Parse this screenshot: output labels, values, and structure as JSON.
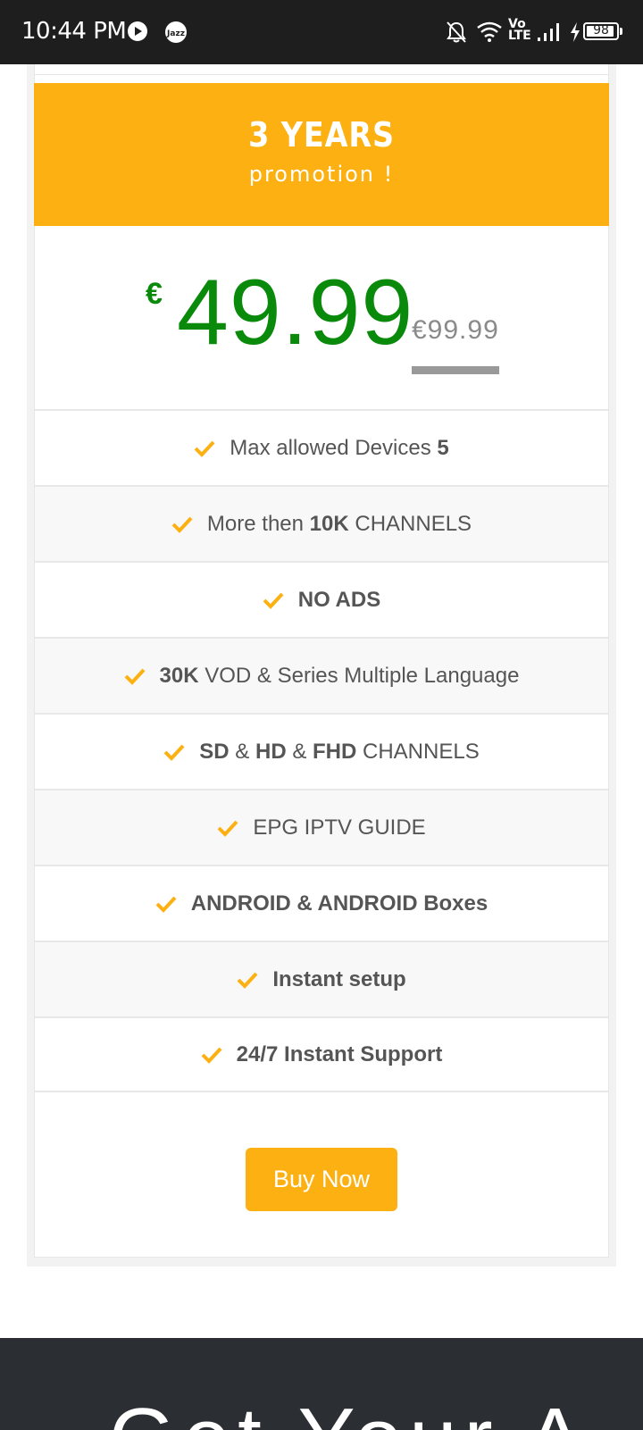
{
  "status_bar": {
    "time": "10:44 PM",
    "battery": "98",
    "network": "Vo LTE"
  },
  "plan": {
    "title": "3 YEARS",
    "subtitle": "promotion !",
    "currency": "€",
    "price": "49.99",
    "old_price": "€99.99",
    "accent_color": "#fdb011",
    "price_color": "#0a8a0a"
  },
  "features": [
    {
      "parts": [
        {
          "t": "Max allowed Devices ",
          "b": false
        },
        {
          "t": "5",
          "b": true
        }
      ]
    },
    {
      "parts": [
        {
          "t": "More then ",
          "b": false
        },
        {
          "t": "10K",
          "b": true
        },
        {
          "t": " CHANNELS",
          "b": false
        }
      ]
    },
    {
      "parts": [
        {
          "t": "NO ADS",
          "b": true
        }
      ]
    },
    {
      "parts": [
        {
          "t": "30K",
          "b": true
        },
        {
          "t": " VOD & Series Multiple Language",
          "b": false
        }
      ]
    },
    {
      "parts": [
        {
          "t": "SD",
          "b": true
        },
        {
          "t": " & ",
          "b": false
        },
        {
          "t": "HD",
          "b": true
        },
        {
          "t": " & ",
          "b": false
        },
        {
          "t": "FHD",
          "b": true
        },
        {
          "t": " CHANNELS",
          "b": false
        }
      ]
    },
    {
      "parts": [
        {
          "t": "EPG IPTV GUIDE",
          "b": false
        }
      ]
    },
    {
      "parts": [
        {
          "t": "ANDROID & ANDROID Boxes",
          "b": true
        }
      ]
    },
    {
      "parts": [
        {
          "t": "Instant setup",
          "b": true
        }
      ]
    },
    {
      "parts": [
        {
          "t": "24/7 Instant Support",
          "b": true
        }
      ]
    }
  ],
  "buy_button": "Buy Now",
  "footer": {
    "heading": "Get Your A"
  }
}
